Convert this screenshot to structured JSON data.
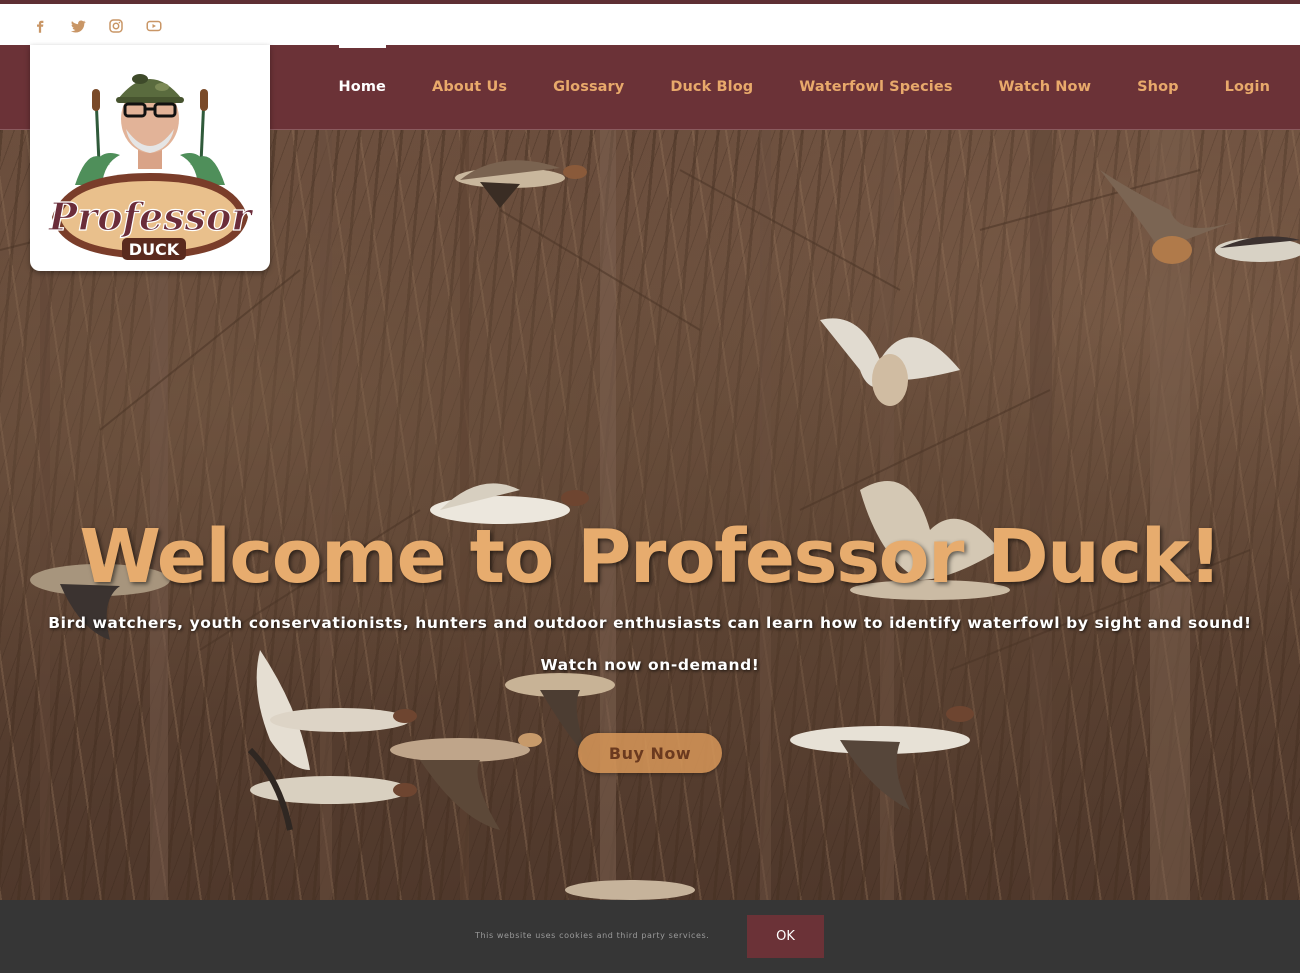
{
  "social": [
    {
      "name": "facebook-icon",
      "label": "f"
    },
    {
      "name": "twitter-icon",
      "label": "twitter"
    },
    {
      "name": "instagram-icon",
      "label": "instagram"
    },
    {
      "name": "youtube-icon",
      "label": "youtube"
    }
  ],
  "colors": {
    "brand_maroon": "#6b3237",
    "accent_orange": "#e7ac6e",
    "social_icon": "#c99666",
    "cookie_bg": "#363636"
  },
  "logo": {
    "line1": "Professor",
    "line2": "DUCK"
  },
  "nav": {
    "items": [
      {
        "label": "Home",
        "active": true
      },
      {
        "label": "About Us"
      },
      {
        "label": "Glossary"
      },
      {
        "label": "Duck Blog"
      },
      {
        "label": "Waterfowl Species"
      },
      {
        "label": "Watch Now"
      },
      {
        "label": "Shop"
      },
      {
        "label": "Login"
      }
    ]
  },
  "hero": {
    "title": "Welcome to Professor Duck!",
    "subtitle": "Bird watchers, youth conservationists, hunters and outdoor enthusiasts can learn how to identify waterfowl by sight and sound!",
    "subtitle2": "Watch now on-demand!",
    "cta_label": "Buy Now"
  },
  "cookie": {
    "text": "This website uses cookies and third party services.",
    "ok_label": "OK"
  }
}
